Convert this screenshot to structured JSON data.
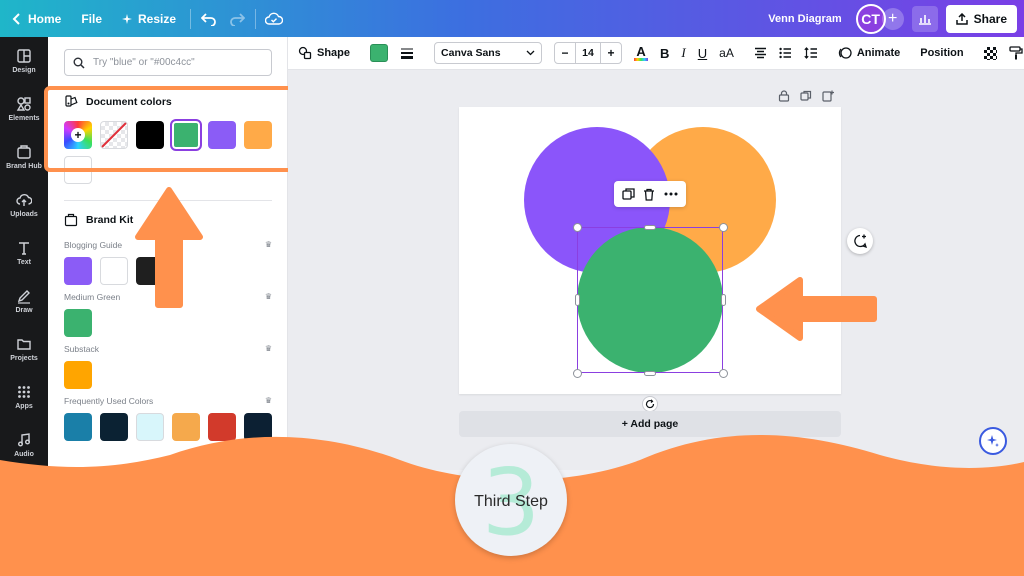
{
  "topbar": {
    "home": "Home",
    "file": "File",
    "resize": "Resize",
    "title": "Venn Diagram",
    "avatar_initials": "CT",
    "share": "Share"
  },
  "rail": [
    {
      "label": "Design",
      "icon": "design-icon"
    },
    {
      "label": "Elements",
      "icon": "elements-icon"
    },
    {
      "label": "Brand Hub",
      "icon": "brand-hub-icon"
    },
    {
      "label": "Uploads",
      "icon": "uploads-icon"
    },
    {
      "label": "Text",
      "icon": "text-icon"
    },
    {
      "label": "Draw",
      "icon": "draw-icon"
    },
    {
      "label": "Projects",
      "icon": "projects-icon"
    },
    {
      "label": "Apps",
      "icon": "apps-icon"
    },
    {
      "label": "Audio",
      "icon": "audio-icon"
    }
  ],
  "panel": {
    "search_placeholder": "Try \"blue\" or \"#00c4cc\"",
    "document_colors": {
      "title": "Document colors",
      "swatches": [
        "rainbow-add",
        "transparent",
        "#000000",
        "#3bb26f",
        "#8b5cf6",
        "#ffaa48",
        "#ffffff"
      ],
      "selected": "#3bb26f"
    },
    "brand_kit": {
      "title": "Brand Kit",
      "groups": [
        {
          "name": "Blogging Guide",
          "colors": [
            "#8b5cf6",
            "#ffffff",
            "#1f1f1f"
          ]
        },
        {
          "name": "Medium Green",
          "colors": [
            "#3bb26f"
          ]
        },
        {
          "name": "Substack",
          "colors": [
            "#ffa500"
          ]
        },
        {
          "name": "Frequently Used Colors",
          "colors": [
            "#1a7fa8",
            "#0b2233",
            "#d8f6fb",
            "#f5a94c",
            "#d23a2b",
            "#0c2033"
          ]
        }
      ]
    }
  },
  "toolbar": {
    "shape": "Shape",
    "font": "Canva Sans",
    "font_size": "14",
    "animate": "Animate",
    "position": "Position",
    "fill_color": "#3bb26f"
  },
  "canvas": {
    "circles": [
      {
        "name": "purple-circle",
        "color": "#8b55fa"
      },
      {
        "name": "orange-circle",
        "color": "#ffaa48"
      },
      {
        "name": "green-circle",
        "color": "#3bb26f"
      }
    ],
    "add_page": "+ Add page"
  },
  "overlay": {
    "accent": "#ff914d",
    "step_number": "3",
    "step_text": "Third Step"
  }
}
